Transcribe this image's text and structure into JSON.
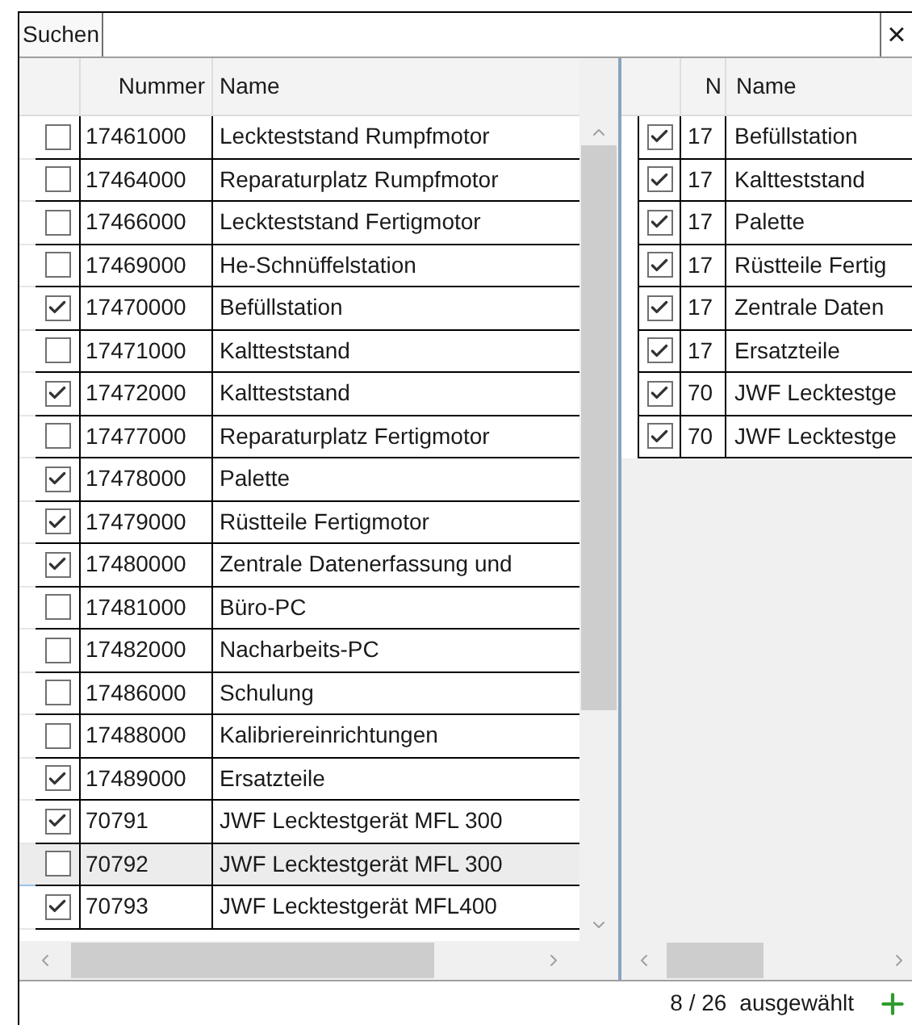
{
  "search": {
    "label": "Suchen",
    "clear": "×"
  },
  "left_grid": {
    "columns": [
      "Nummer",
      "Name"
    ],
    "rows": [
      {
        "checked": false,
        "selected": false,
        "number": "17461000",
        "name": "Leckteststand Rumpfmotor"
      },
      {
        "checked": false,
        "selected": false,
        "number": "17464000",
        "name": "Reparaturplatz Rumpfmotor"
      },
      {
        "checked": false,
        "selected": false,
        "number": "17466000",
        "name": "Leckteststand Fertigmotor"
      },
      {
        "checked": false,
        "selected": false,
        "number": "17469000",
        "name": "He-Schnüffelstation"
      },
      {
        "checked": true,
        "selected": false,
        "number": "17470000",
        "name": "Befüllstation"
      },
      {
        "checked": false,
        "selected": false,
        "number": "17471000",
        "name": "Kaltteststand"
      },
      {
        "checked": true,
        "selected": false,
        "number": "17472000",
        "name": "Kaltteststand"
      },
      {
        "checked": false,
        "selected": false,
        "number": "17477000",
        "name": "Reparaturplatz Fertigmotor"
      },
      {
        "checked": true,
        "selected": false,
        "number": "17478000",
        "name": "Palette"
      },
      {
        "checked": true,
        "selected": false,
        "number": "17479000",
        "name": "Rüstteile Fertigmotor"
      },
      {
        "checked": true,
        "selected": false,
        "number": "17480000",
        "name": "Zentrale Datenerfassung und"
      },
      {
        "checked": false,
        "selected": false,
        "number": "17481000",
        "name": "Büro-PC"
      },
      {
        "checked": false,
        "selected": false,
        "number": "17482000",
        "name": "Nacharbeits-PC"
      },
      {
        "checked": false,
        "selected": false,
        "number": "17486000",
        "name": "Schulung"
      },
      {
        "checked": false,
        "selected": false,
        "number": "17488000",
        "name": "Kalibriereinrichtungen"
      },
      {
        "checked": true,
        "selected": false,
        "number": "17489000",
        "name": "Ersatzteile"
      },
      {
        "checked": true,
        "selected": false,
        "number": "70791",
        "name": "JWF Lecktestgerät MFL 300"
      },
      {
        "checked": false,
        "selected": true,
        "number": "70792",
        "name": "JWF Lecktestgerät MFL 300"
      },
      {
        "checked": true,
        "selected": false,
        "number": "70793",
        "name": "JWF Lecktestgerät MFL400"
      }
    ]
  },
  "right_grid": {
    "columns": [
      "N",
      "Name"
    ],
    "rows": [
      {
        "checked": true,
        "number": "17",
        "name": "Befüllstation"
      },
      {
        "checked": true,
        "number": "17",
        "name": "Kaltteststand"
      },
      {
        "checked": true,
        "number": "17",
        "name": "Palette"
      },
      {
        "checked": true,
        "number": "17",
        "name": "Rüstteile Fertig"
      },
      {
        "checked": true,
        "number": "17",
        "name": "Zentrale Daten"
      },
      {
        "checked": true,
        "number": "17",
        "name": "Ersatzteile"
      },
      {
        "checked": true,
        "number": "70",
        "name": "JWF Lecktestge"
      },
      {
        "checked": true,
        "number": "70",
        "name": "JWF Lecktestge"
      }
    ]
  },
  "status_bar": {
    "selection": "8 / 26",
    "label": "ausgewählt"
  }
}
